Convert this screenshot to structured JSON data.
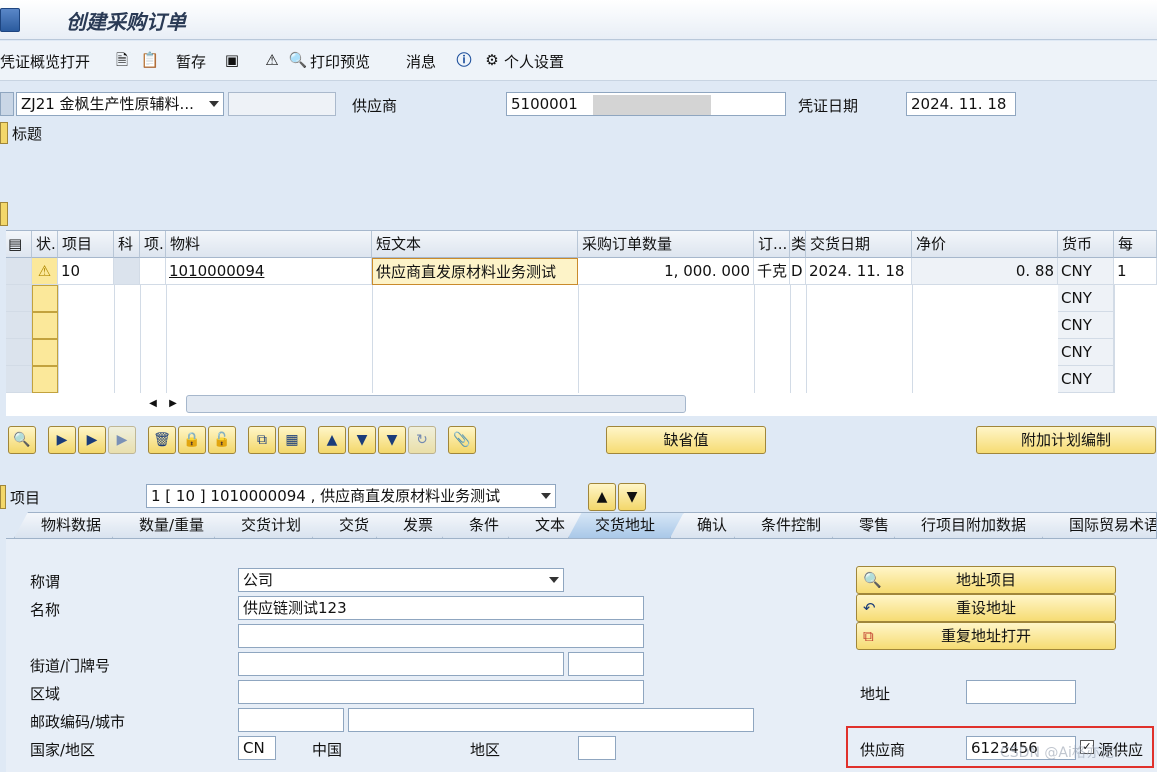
{
  "window": {
    "title": "创建采购订单"
  },
  "toolbar": {
    "items": [
      "凭证概览打开",
      "暂存",
      "打印预览",
      "消息",
      "个人设置"
    ]
  },
  "header": {
    "doc_type": "ZJ21 金枫生产性原辅料...",
    "vendor_label": "供应商",
    "vendor_value": "5100001",
    "doc_date_label": "凭证日期",
    "doc_date_value": "2024. 11. 18",
    "header_toggle": "标题"
  },
  "grid": {
    "columns": [
      "状.",
      "项目",
      "科",
      "项.",
      "物料",
      "短文本",
      "采购订单数量",
      "订...",
      "类",
      "交货日期",
      "净价",
      "货币",
      "每"
    ],
    "rows": [
      {
        "item": "10",
        "material": "1010000094",
        "short_text": "供应商直发原材料业务测试",
        "qty": "1, 000. 000",
        "unit": "千克",
        "cat": "D",
        "delivery_date": "2024. 11. 18",
        "net_price": "0. 88",
        "currency": "CNY",
        "per": "1"
      },
      {
        "currency": "CNY"
      },
      {
        "currency": "CNY"
      },
      {
        "currency": "CNY"
      },
      {
        "currency": "CNY"
      }
    ]
  },
  "buttons": {
    "defaults": "缺省值",
    "additional_planning": "附加计划编制"
  },
  "item_section": {
    "label": "项目",
    "selected": "1 [ 10 ] 1010000094 , 供应商直发原材料业务测试"
  },
  "tabs": [
    "物料数据",
    "数量/重量",
    "交货计划",
    "交货",
    "发票",
    "条件",
    "文本",
    "交货地址",
    "确认",
    "条件控制",
    "零售",
    "行项目附加数据",
    "国际贸易术语"
  ],
  "active_tab": "交货地址",
  "address": {
    "title_label": "称谓",
    "title_value": "公司",
    "name_label": "名称",
    "name_value": "供应链测试123",
    "street_label": "街道/门牌号",
    "district_label": "区域",
    "postal_label": "邮政编码/城市",
    "country_label": "国家/地区",
    "country_code": "CN",
    "country_name": "中国",
    "region_label": "地区",
    "addr_item_btn": "地址项目",
    "reset_btn": "重设地址",
    "repeat_btn": "重复地址打开",
    "address_label": "地址",
    "vendor_label": "供应商",
    "vendor_value": "6123456",
    "checkbox_label": "源供应"
  },
  "watermark": "CSDN @Ai格亦花"
}
